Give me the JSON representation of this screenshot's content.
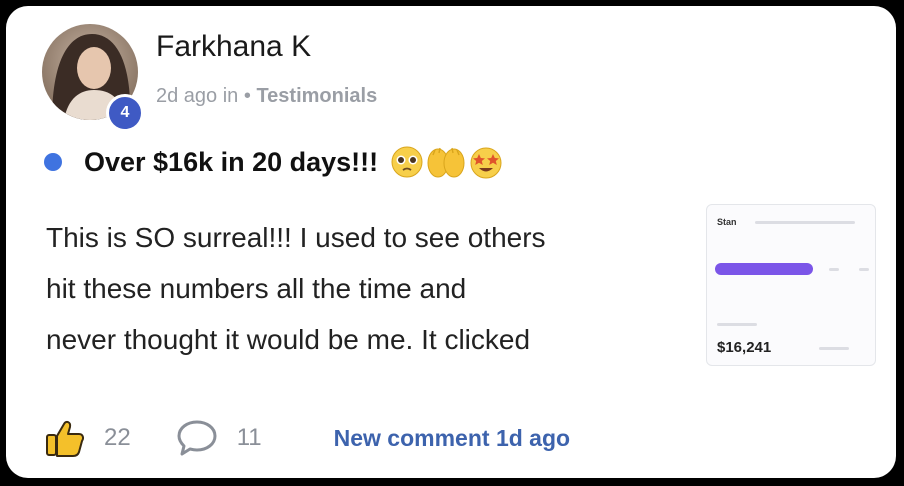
{
  "post": {
    "author": "Farkhana K",
    "level": "4",
    "time": "2d ago in",
    "separator": "•",
    "category": "Testimonials",
    "title": "Over $16k in 20 days!!!",
    "emojis": [
      "pleading-face",
      "raised-hands",
      "star-struck"
    ],
    "body_lines": [
      "This is SO surreal!!! I used to see others",
      "hit these numbers all the time and",
      "never thought it would be me. It clicked"
    ],
    "thumbnail": {
      "title": "Stan",
      "amount": "$16,241"
    }
  },
  "footer": {
    "likes": "22",
    "comments": "11",
    "new_comment": "New comment 1d ago"
  },
  "colors": {
    "accent_blue": "#3f73e0",
    "badge_blue": "#3f5ac4",
    "link_blue": "#3d63ad",
    "like_yellow": "#f4c02a",
    "thumb_purple": "#7b55e8"
  },
  "icons": [
    "avatar",
    "thumbs-up-icon",
    "comment-bubble-icon",
    "unread-dot-icon"
  ]
}
